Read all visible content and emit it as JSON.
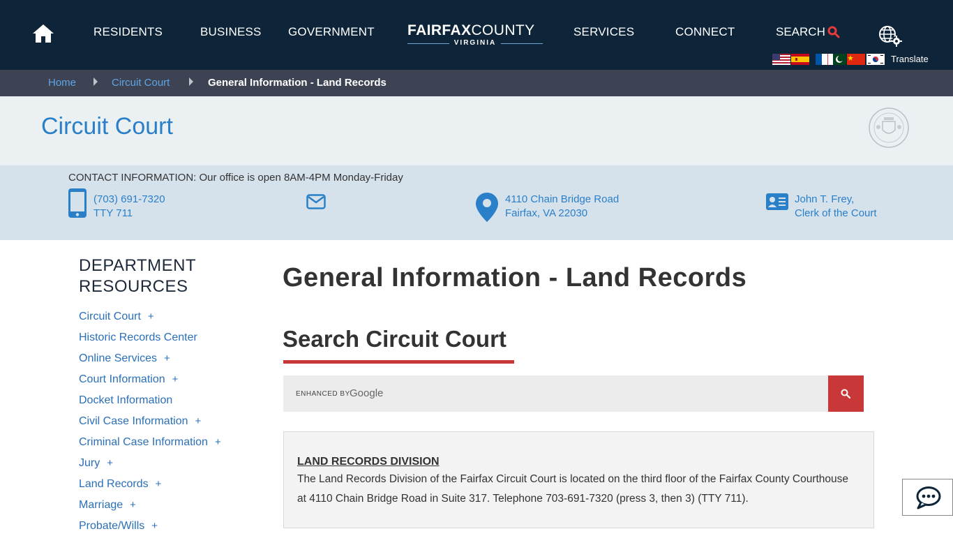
{
  "nav": {
    "items": [
      "RESIDENTS",
      "BUSINESS",
      "GOVERNMENT",
      "SERVICES",
      "CONNECT"
    ],
    "search_label": "SEARCH",
    "translate_label": "Translate",
    "flags": [
      "us-flag",
      "spain-flag",
      "france-flag",
      "pakistan-flag",
      "china-flag",
      "korea-flag"
    ]
  },
  "logo": {
    "fairfax": "FAIRFAX",
    "county": "COUNTY",
    "virginia": "VIRGINIA"
  },
  "breadcrumb": {
    "home": "Home",
    "section": "Circuit Court",
    "current": "General Information - Land Records"
  },
  "dept": {
    "title": "Circuit Court"
  },
  "contact": {
    "heading": "CONTACT INFORMATION: Our office is open 8AM-4PM Monday-Friday",
    "phone": "(703) 691-7320",
    "tty": "TTY 711",
    "address_line1": "4110 Chain Bridge Road",
    "address_line2": "Fairfax, VA 22030",
    "clerk_line1": "John T. Frey,",
    "clerk_line2": "Clerk of the Court"
  },
  "sidebar": {
    "title_line1": "DEPARTMENT",
    "title_line2": "RESOURCES",
    "items": [
      {
        "label": "Circuit Court",
        "plus": "+"
      },
      {
        "label": "Historic Records Center",
        "plus": ""
      },
      {
        "label": "Online Services",
        "plus": "+"
      },
      {
        "label": "Court Information",
        "plus": "+"
      },
      {
        "label": "Docket Information",
        "plus": ""
      },
      {
        "label": "Civil Case Information",
        "plus": "+"
      },
      {
        "label": "Criminal Case Information",
        "plus": "+"
      },
      {
        "label": "Jury",
        "plus": "+"
      },
      {
        "label": "Land Records",
        "plus": "+"
      },
      {
        "label": "Marriage",
        "plus": "+"
      },
      {
        "label": "Probate/Wills",
        "plus": "+"
      }
    ]
  },
  "main": {
    "title": "General Information - Land Records",
    "search_title": "Search Circuit Court",
    "enhanced_by": "ENHANCED BY",
    "google": "Google",
    "info_title": "LAND RECORDS DIVISION",
    "info_text": "The Land Records Division of the Fairfax Circuit Court is located on the third floor of the Fairfax County Courthouse at 4110 Chain Bridge Road in Suite 317. Telephone 703-691-7320 (press 3, then 3) (TTY 711)."
  },
  "colors": {
    "nav_bg": "#0e2439",
    "crumb_bg": "#3d4352",
    "link_blue": "#2a7fc9",
    "accent_red": "#c93838"
  }
}
